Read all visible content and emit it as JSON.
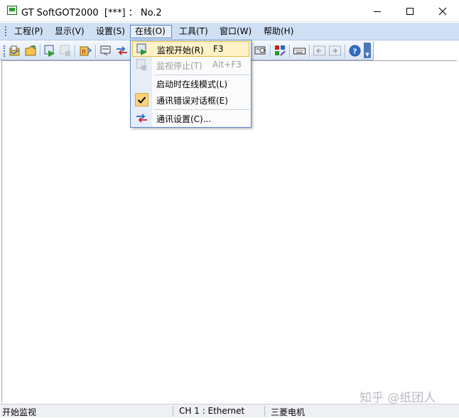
{
  "window": {
    "title": "GT SoftGOT2000  [***] ： No.2",
    "buttons": {
      "minimize": "minimize",
      "maximize": "maximize",
      "close": "close"
    }
  },
  "menubar": {
    "items": [
      {
        "label": "工程(P)"
      },
      {
        "label": "显示(V)"
      },
      {
        "label": "设置(S)"
      },
      {
        "label": "在线(O)"
      },
      {
        "label": "工具(T)"
      },
      {
        "label": "窗口(W)"
      },
      {
        "label": "帮助(H)"
      }
    ],
    "active_index": 3
  },
  "toolbar": {
    "icons": [
      "open-project-icon",
      "open-folder-icon",
      "monitor-start-icon",
      "monitor-stop-icon",
      "load-project-icon",
      "screen-icon",
      "communication-icon",
      "device-icon",
      "palette-icon",
      "keyboard-icon",
      "prev-screen-icon",
      "next-screen-icon",
      "help-icon",
      "toolbar-options-icon"
    ]
  },
  "dropdown": {
    "items": [
      {
        "label": "监视开始(R)",
        "shortcut": "F3",
        "icon": "monitor-start-icon",
        "state": "highlighted"
      },
      {
        "label": "监视停止(T)",
        "shortcut": "Alt+F3",
        "icon": "monitor-stop-icon",
        "state": "disabled"
      },
      {
        "label": "启动时在线模式(L)",
        "shortcut": "",
        "icon": "",
        "state": "normal"
      },
      {
        "label": "通讯错误对话框(E)",
        "shortcut": "",
        "icon": "check-icon",
        "state": "checked"
      },
      {
        "label": "通讯设置(C)...",
        "shortcut": "",
        "icon": "communication-settings-icon",
        "state": "normal"
      }
    ]
  },
  "statusbar": {
    "message": "开始监视",
    "channel": "CH 1 : Ethernet",
    "vendor": "三菱电机"
  },
  "watermark": "知乎 @纸团人",
  "colors": {
    "menubar_bg": "#cfe0f4",
    "highlight_bg": "#fff1c8",
    "highlight_border": "#e6b83d",
    "menu_border": "#5b87c6"
  }
}
